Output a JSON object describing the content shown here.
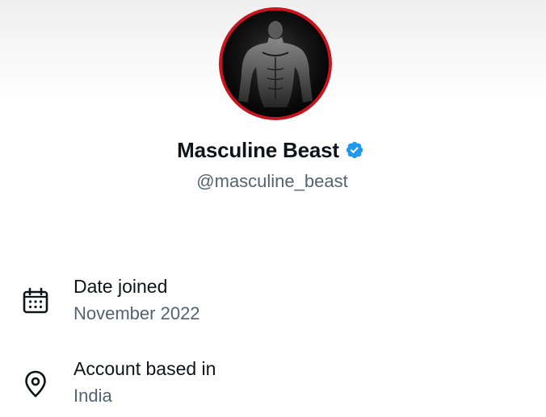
{
  "profile": {
    "display_name": "Masculine Beast",
    "handle": "@masculine_beast",
    "verified": true,
    "avatar_ring_color": "#c8141e",
    "verified_color": "#1d9bf0"
  },
  "about": [
    {
      "icon": "calendar-icon",
      "label": "Date joined",
      "value": "November 2022"
    },
    {
      "icon": "location-pin-icon",
      "label": "Account based in",
      "value": "India"
    }
  ]
}
